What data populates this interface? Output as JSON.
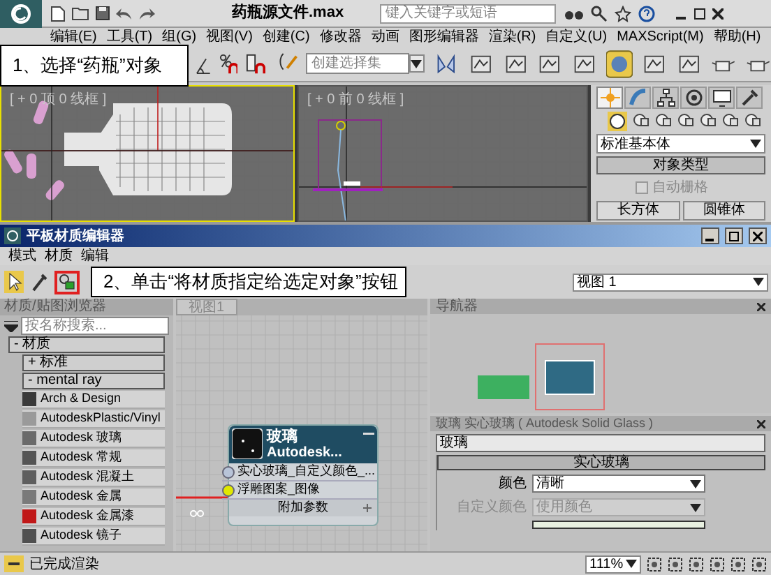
{
  "app": {
    "title": "药瓶源文件.max",
    "search": {
      "placeholder": "键入关键字或短语"
    }
  },
  "menu": [
    "编辑(E)",
    "工具(T)",
    "组(G)",
    "视图(V)",
    "创建(C)",
    "修改器",
    "动画",
    "图形编辑器",
    "渲染(R)",
    "自定义(U)",
    "MAXScript(M)",
    "帮助(H)"
  ],
  "toolbar": {
    "selection_set": {
      "placeholder": "创建选择集"
    }
  },
  "callouts": [
    "1、选择“药瓶”对象",
    "2、单击“将材质指定给选定对象”按钮"
  ],
  "viewports": [
    {
      "label": "[ + 0 顶 0 线框 ]",
      "active": true
    },
    {
      "label": "[ + 0 前 0 线框 ]",
      "active": false
    }
  ],
  "command_panel": {
    "tabs": [
      {
        "kind": "create",
        "selected": true
      },
      {
        "kind": "modify",
        "selected": false
      },
      {
        "kind": "hierarchy",
        "selected": false
      },
      {
        "kind": "motion",
        "selected": false
      },
      {
        "kind": "display",
        "selected": false
      },
      {
        "kind": "utilities",
        "selected": false
      }
    ],
    "category": "标准基本体",
    "rollout": "对象类型",
    "auto_grid": {
      "label": "自动栅格",
      "checked": false,
      "disabled": true
    },
    "buttons": [
      "长方体",
      "圆锥体"
    ]
  },
  "material_editor": {
    "title": "平板材质编辑器",
    "menu": [
      "模式",
      "材质",
      "编辑"
    ],
    "view_select": "视图 1",
    "browser": {
      "title": "材质/贴图浏览器",
      "search": {
        "placeholder": "按名称搜索..."
      },
      "groups": [
        "- 材质",
        "+ 标准",
        "- mental ray"
      ],
      "items": [
        {
          "label": "Arch & Design",
          "color": "#3a3a3a"
        },
        {
          "label": "AutodeskPlastic/Vinyl",
          "color": "#9a9a9a"
        },
        {
          "label": "Autodesk 玻璃",
          "color": "#6a6a6a"
        },
        {
          "label": "Autodesk 常规",
          "color": "#555555"
        },
        {
          "label": "Autodesk 混凝土",
          "color": "#5e5e5e"
        },
        {
          "label": "Autodesk 金属",
          "color": "#7a7a7a"
        },
        {
          "label": "Autodesk 金属漆",
          "color": "#c01818"
        },
        {
          "label": "Autodesk 镜子",
          "color": "#505050"
        }
      ]
    },
    "view_tab": "视图1",
    "node": {
      "title": "玻璃",
      "subtitle": "Autodesk...",
      "slots": [
        {
          "label": "实心玻璃_自定义颜色_...",
          "connected": false
        },
        {
          "label": "浮雕图案_图像",
          "connected": true
        }
      ],
      "footer": "附加参数"
    },
    "navigator": {
      "title": "导航器"
    },
    "params": {
      "title": "玻璃 实心玻璃 ( Autodesk Solid Glass )",
      "name": "玻璃",
      "rollout": "实心玻璃",
      "rows": [
        {
          "label": "颜色",
          "value": "清晰",
          "disabled": false
        },
        {
          "label": "自定义颜色",
          "value": "使用颜色",
          "disabled": true
        }
      ]
    },
    "status": "已完成渲染",
    "zoom": "111%"
  }
}
